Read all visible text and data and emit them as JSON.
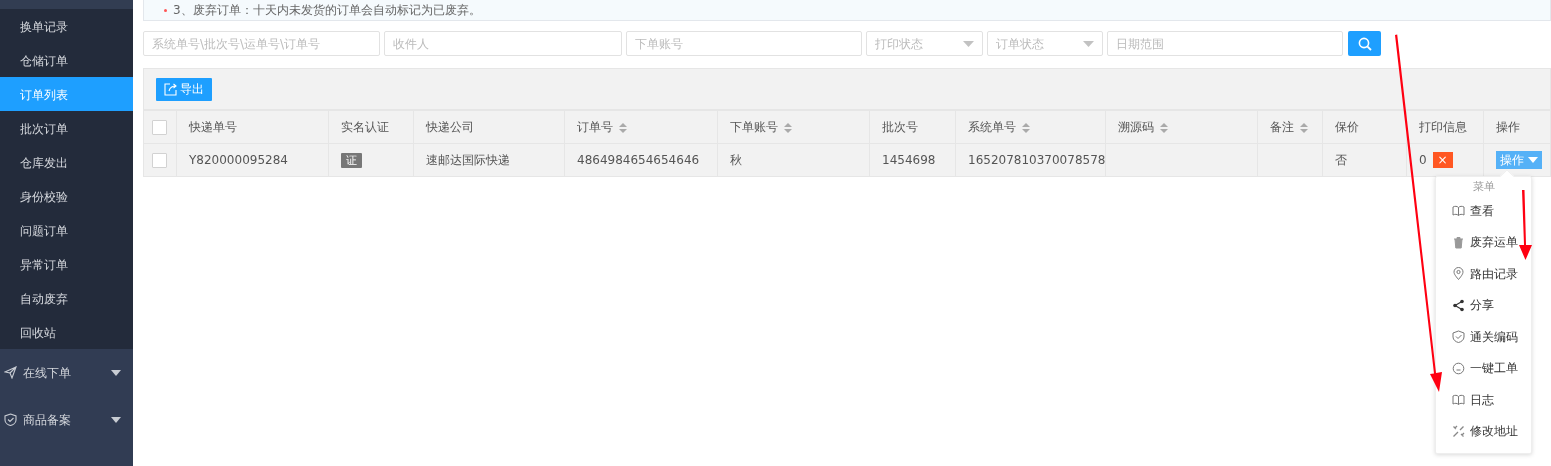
{
  "notice": {
    "text": "3、废弃订单：十天内未发货的订单会自动标记为已废弃。"
  },
  "sidebar": {
    "items": [
      {
        "label": "换单记录",
        "selected": false
      },
      {
        "label": "仓储订单",
        "selected": false
      },
      {
        "label": "订单列表",
        "selected": true
      },
      {
        "label": "批次订单",
        "selected": false
      },
      {
        "label": "仓库发出",
        "selected": false
      },
      {
        "label": "身份校验",
        "selected": false
      },
      {
        "label": "问题订单",
        "selected": false
      },
      {
        "label": "异常订单",
        "selected": false
      },
      {
        "label": "自动废弃",
        "selected": false
      },
      {
        "label": "回收站",
        "selected": false
      }
    ],
    "groups": [
      {
        "label": "在线下单",
        "expanded": false
      },
      {
        "label": "商品备案",
        "expanded": false
      }
    ]
  },
  "filters": [
    {
      "kind": "input",
      "placeholder": "系统单号\\批次号\\运单号\\订单号"
    },
    {
      "kind": "input",
      "placeholder": "收件人"
    },
    {
      "kind": "input",
      "placeholder": "下单账号"
    },
    {
      "kind": "select",
      "placeholder": "打印状态"
    },
    {
      "kind": "select",
      "placeholder": "订单状态"
    },
    {
      "kind": "input",
      "placeholder": "日期范围"
    }
  ],
  "toolbar": {
    "export_label": "导出"
  },
  "table": {
    "header_checked": false,
    "columns": [
      {
        "label": "快递单号",
        "sortable": false
      },
      {
        "label": "实名认证",
        "sortable": false
      },
      {
        "label": "快递公司",
        "sortable": false
      },
      {
        "label": "订单号",
        "sortable": true
      },
      {
        "label": "下单账号",
        "sortable": true
      },
      {
        "label": "批次号",
        "sortable": false
      },
      {
        "label": "系统单号",
        "sortable": true
      },
      {
        "label": "溯源码",
        "sortable": true
      },
      {
        "label": "备注",
        "sortable": true
      },
      {
        "label": "保价",
        "sortable": false
      },
      {
        "label": "打印信息",
        "sortable": false
      },
      {
        "label": "操作",
        "sortable": false
      }
    ],
    "rows": [
      {
        "checked": false,
        "tracking_no": "Y820000095284",
        "real_name": "证",
        "courier": "速邮达国际快递",
        "order_no": "4864984654654646",
        "account": "秋",
        "batch_no": "1454698",
        "system_no": "165207810370078578",
        "insured": "否",
        "print_count": "0",
        "print_cancel": "×",
        "action": "操作"
      }
    ]
  },
  "action_menu": {
    "title": "菜单",
    "items": [
      {
        "label": "查看"
      },
      {
        "label": "废弃运单"
      },
      {
        "label": "路由记录"
      },
      {
        "label": "分享"
      },
      {
        "label": "通关编码"
      },
      {
        "label": "一键工单"
      },
      {
        "label": "日志"
      },
      {
        "label": "修改地址"
      }
    ]
  }
}
